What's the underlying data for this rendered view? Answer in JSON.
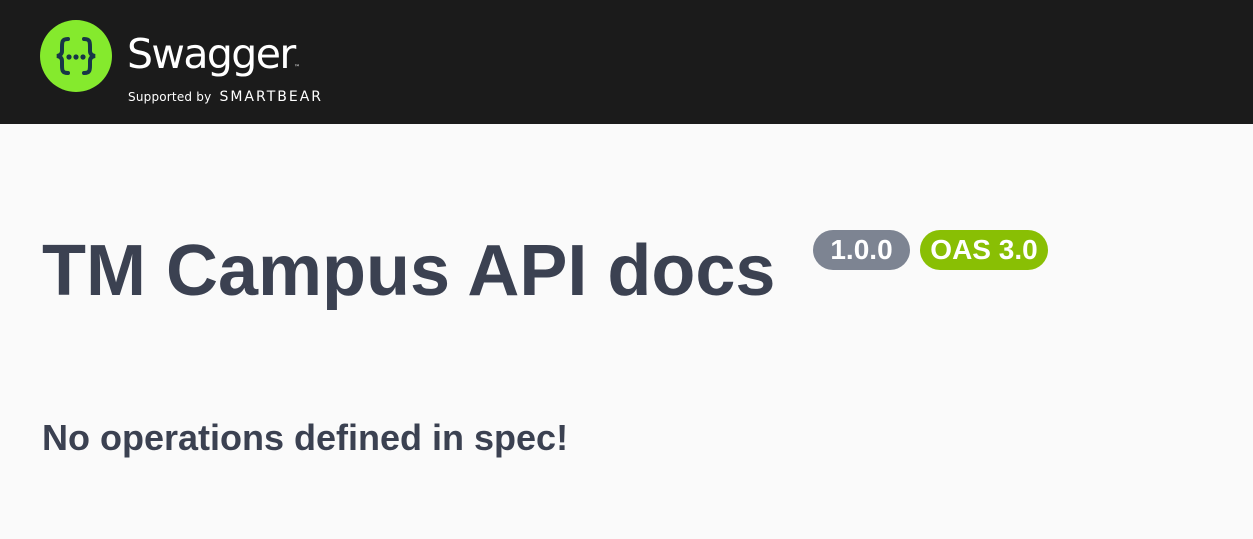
{
  "topbar": {
    "logo": {
      "wordmark": "Swagger",
      "trademark": "™",
      "supported_by": "Supported by",
      "brand": "SMARTBEAR",
      "icon": "swagger-braces-icon",
      "circle_color": "#85ea2d",
      "glyph_color": "#173647"
    },
    "background_color": "#1b1b1b"
  },
  "info": {
    "title": "TM Campus API docs",
    "version_badge": "1.0.0",
    "oas_badge": "OAS 3.0",
    "version_badge_color": "#7d8492",
    "oas_badge_color": "#89bf04"
  },
  "operations": {
    "empty_message": "No operations defined in spec!"
  },
  "colors": {
    "page_background": "#fafafa",
    "text": "#3b4151"
  }
}
